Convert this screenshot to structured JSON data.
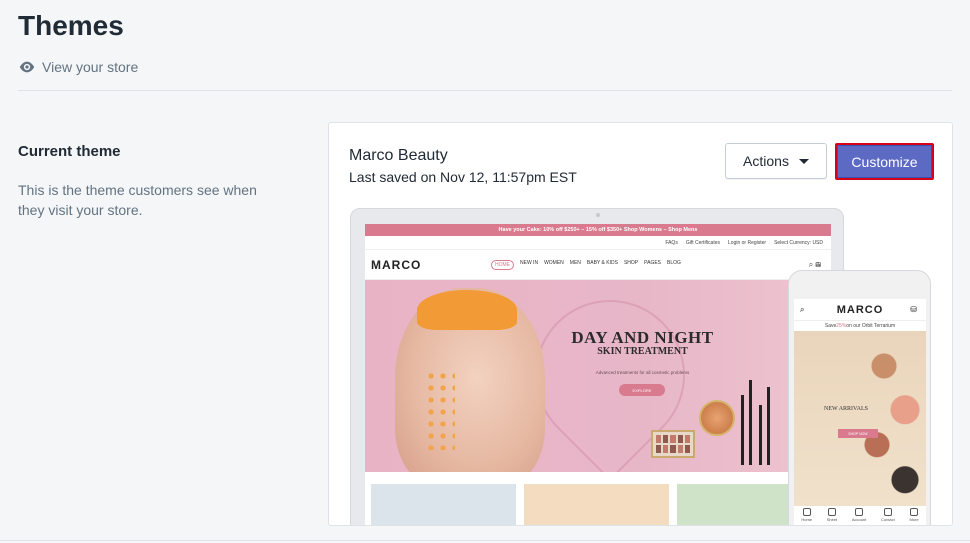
{
  "page": {
    "title": "Themes",
    "view_store": "View your store"
  },
  "section": {
    "title": "Current theme",
    "description": "This is the theme customers see when they visit your store."
  },
  "theme": {
    "name": "Marco Beauty",
    "saved": "Last saved on Nov 12, 11:57pm EST",
    "actions_label": "Actions",
    "customize_label": "Customize"
  },
  "preview": {
    "promo": "Have your Cake:   10% off $250+  –  15% off $350+  Shop Womens  –  Shop Mens",
    "util_links": [
      "FAQs",
      "Gift Certificates",
      "Login or Register",
      "Select Currency: USD"
    ],
    "logo": "MARCO",
    "nav": [
      "HOME",
      "NEW IN",
      "WOMEN",
      "MEN",
      "BABY & KIDS",
      "SHOP",
      "PAGES",
      "BLOG"
    ],
    "hero_title": "DAY AND NIGHT",
    "hero_subtitle": "SKIN TREATMENT",
    "hero_text": "Advanced treatments for all cosmetic problems",
    "hero_button": "EXPLORE",
    "mobile_promo_prefix": "Save ",
    "mobile_promo_pct": "25%",
    "mobile_promo_suffix": " on our Orbit Terrarium",
    "mobile_hero": "NEW ARRIVALS",
    "mobile_button": "SHOP NOW",
    "mobile_tabs": [
      "Home",
      "Sheet",
      "Account",
      "Contact",
      "More"
    ]
  },
  "colors": {
    "accent": "#5c6ac4",
    "highlight_border": "#d6001c",
    "brand_pink": "#d97a8e"
  }
}
